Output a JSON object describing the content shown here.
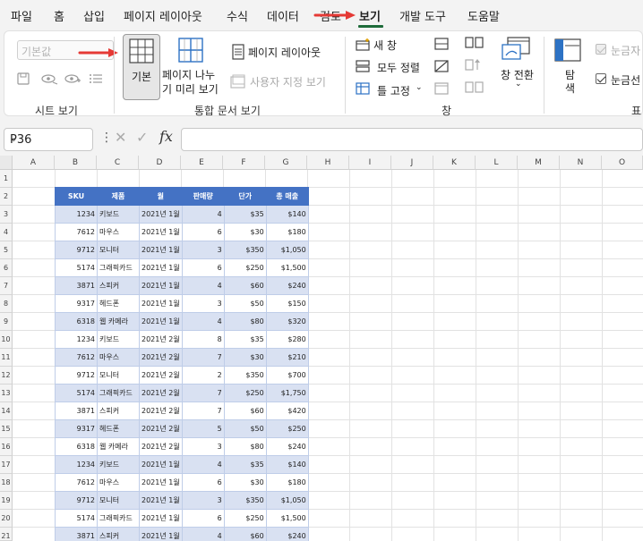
{
  "menu": {
    "items": [
      "파일",
      "홈",
      "삽입",
      "페이지 레이아웃",
      "수식",
      "데이터",
      "검토",
      "보기",
      "개발 도구",
      "도움말"
    ],
    "active": "보기"
  },
  "ribbon": {
    "sheet_view": {
      "combo_value": "기본값",
      "group_label": "시트 보기"
    },
    "workbook_views": {
      "normal": "기본",
      "page_break_line1": "페이지 나누",
      "page_break_line2": "기 미리 보기",
      "page_layout": "페이지 레이아웃",
      "custom_views": "사용자 지정 보기",
      "group_label": "통합 문서 보기"
    },
    "window": {
      "new_window": "새 창",
      "arrange_all": "모두 정렬",
      "freeze_panes": "틀 고정",
      "switch_windows": "창 전환",
      "group_label": "창"
    },
    "show": {
      "navigation_line1": "탐",
      "navigation_line2": "색",
      "ruler": "눈금자",
      "gridlines": "눈금선",
      "group_label": "표"
    }
  },
  "formula_bar": {
    "name_box": "P36",
    "fx": "fx",
    "formula": ""
  },
  "grid": {
    "columns": [
      "A",
      "B",
      "C",
      "D",
      "E",
      "F",
      "G",
      "H",
      "I",
      "J",
      "K",
      "L",
      "M",
      "N",
      "O"
    ],
    "rows": [
      "1",
      "2",
      "3",
      "4",
      "5",
      "6",
      "7",
      "8",
      "9",
      "10",
      "11",
      "12",
      "13",
      "14",
      "15",
      "16",
      "17",
      "18",
      "19",
      "20",
      "21"
    ]
  },
  "table": {
    "headers": [
      "SKU",
      "제품",
      "월",
      "판매량",
      "단가",
      "총 매출"
    ],
    "rows": [
      [
        "1234",
        "키보드",
        "2021년 1월",
        "4",
        "$35",
        "$140"
      ],
      [
        "7612",
        "마우스",
        "2021년 1월",
        "6",
        "$30",
        "$180"
      ],
      [
        "9712",
        "모니터",
        "2021년 1월",
        "3",
        "$350",
        "$1,050"
      ],
      [
        "5174",
        "그래픽카드",
        "2021년 1월",
        "6",
        "$250",
        "$1,500"
      ],
      [
        "3871",
        "스피커",
        "2021년 1월",
        "4",
        "$60",
        "$240"
      ],
      [
        "9317",
        "헤드폰",
        "2021년 1월",
        "3",
        "$50",
        "$150"
      ],
      [
        "6318",
        "웹 카메라",
        "2021년 1월",
        "4",
        "$80",
        "$320"
      ],
      [
        "1234",
        "키보드",
        "2021년 2월",
        "8",
        "$35",
        "$280"
      ],
      [
        "7612",
        "마우스",
        "2021년 2월",
        "7",
        "$30",
        "$210"
      ],
      [
        "9712",
        "모니터",
        "2021년 2월",
        "2",
        "$350",
        "$700"
      ],
      [
        "5174",
        "그래픽카드",
        "2021년 2월",
        "7",
        "$250",
        "$1,750"
      ],
      [
        "3871",
        "스피커",
        "2021년 2월",
        "7",
        "$60",
        "$420"
      ],
      [
        "9317",
        "헤드폰",
        "2021년 2월",
        "5",
        "$50",
        "$250"
      ],
      [
        "6318",
        "웹 카메라",
        "2021년 2월",
        "3",
        "$80",
        "$240"
      ],
      [
        "1234",
        "키보드",
        "2021년 1월",
        "4",
        "$35",
        "$140"
      ],
      [
        "7612",
        "마우스",
        "2021년 1월",
        "6",
        "$30",
        "$180"
      ],
      [
        "9712",
        "모니터",
        "2021년 1월",
        "3",
        "$350",
        "$1,050"
      ],
      [
        "5174",
        "그래픽카드",
        "2021년 1월",
        "6",
        "$250",
        "$1,500"
      ],
      [
        "3871",
        "스피커",
        "2021년 1월",
        "4",
        "$60",
        "$240"
      ]
    ]
  },
  "colors": {
    "accent": "#1e6b3a",
    "header_fill": "#4472c4",
    "band_fill": "#d9e1f2",
    "annotation_arrow": "#e53935"
  },
  "icons": {
    "arrow_to_view_tab": "red-arrow-icon",
    "arrow_to_normal_button": "red-arrow-icon"
  }
}
